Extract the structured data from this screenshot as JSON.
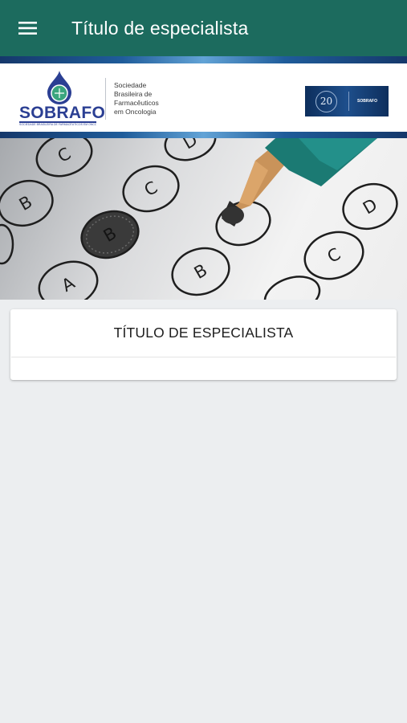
{
  "app_bar": {
    "menu_icon": "hamburger-menu-icon",
    "title": "Título de especialista",
    "background": "#1c6b5e"
  },
  "header_banner": {
    "logo_name": "SOBRAFO",
    "logo_subtitle": "SOCIEDADE BRASILEIRA DE FARMACÊUTICOS EM ONCOLOGIA",
    "tagline_lines": [
      "Sociedade",
      "Brasileira de",
      "Farmacêuticos",
      "em Oncologia"
    ],
    "badge_number": "20",
    "badge_brand": "SOBRAFO",
    "brand_color": "#2b3f93"
  },
  "hero_image": {
    "bubbles": [
      "C",
      "D",
      "B",
      "C",
      "A",
      "B",
      "B",
      "C",
      "D"
    ]
  },
  "card": {
    "title": "TÍTULO DE ESPECIALISTA"
  }
}
